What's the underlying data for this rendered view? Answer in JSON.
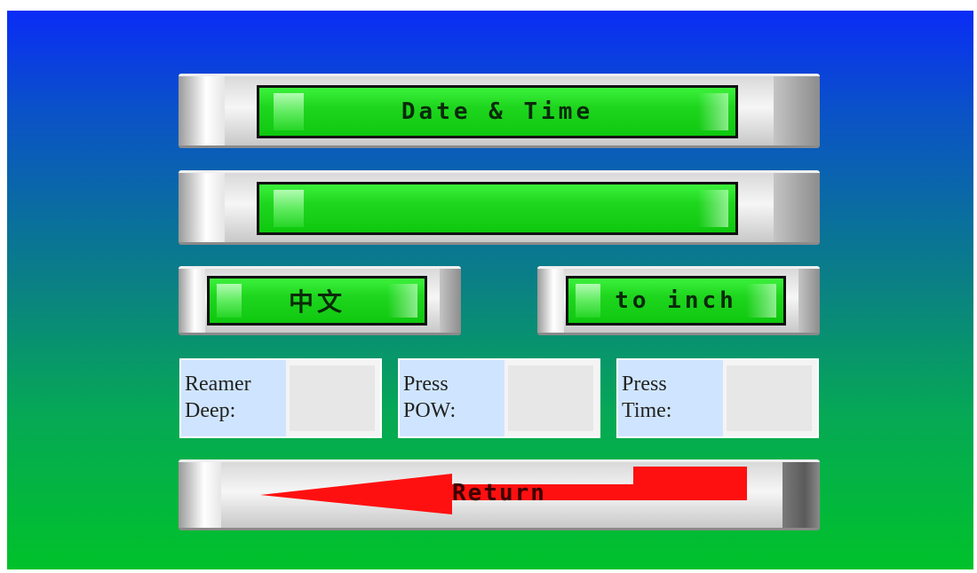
{
  "buttons": {
    "date_time": "Date & Time",
    "blank": "",
    "chinese": "中文",
    "to_inch": "to inch",
    "return": "Return"
  },
  "params": [
    {
      "label_line1": "Reamer",
      "label_line2": "Deep:",
      "value": ""
    },
    {
      "label_line1": "Press",
      "label_line2": "POW:",
      "value": ""
    },
    {
      "label_line1": "Press",
      "label_line2": "Time:",
      "value": ""
    }
  ],
  "colors": {
    "button_green": "#1fd61f",
    "arrow_red": "#ff0000",
    "label_bg": "#cfe5ff"
  },
  "icons": {
    "return_arrow": "left-arrow-icon"
  }
}
